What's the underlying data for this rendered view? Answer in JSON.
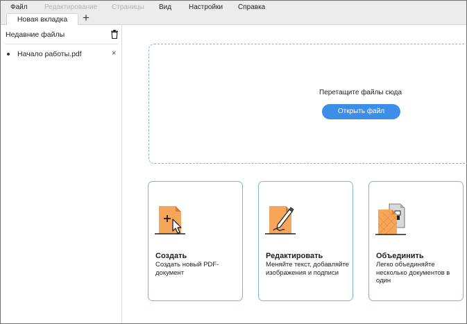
{
  "menubar": {
    "items": [
      {
        "label": "Файл",
        "enabled": true
      },
      {
        "label": "Редактирование",
        "enabled": false
      },
      {
        "label": "Страницы",
        "enabled": false
      },
      {
        "label": "Вид",
        "enabled": true
      },
      {
        "label": "Настройки",
        "enabled": true
      },
      {
        "label": "Справка",
        "enabled": true
      }
    ]
  },
  "tabs": {
    "active_label": "Новая вкладка",
    "new_tab_symbol": "+"
  },
  "sidebar": {
    "title": "Недавние файлы",
    "files": [
      {
        "name": "Начало работы.pdf",
        "close_symbol": "×"
      }
    ]
  },
  "dropzone": {
    "text": "Перетащите файлы сюда",
    "button_label": "Открыть файл"
  },
  "cards": [
    {
      "icon": "create-pdf-icon",
      "title": "Создать",
      "desc": "Создать новый PDF-документ"
    },
    {
      "icon": "edit-pdf-icon",
      "title": "Редактировать",
      "desc": "Меняйте текст, добавляйте изображения и подписи"
    },
    {
      "icon": "merge-pdf-icon",
      "title": "Объединить",
      "desc": "Легко объединяйте несколько документов в один"
    }
  ],
  "colors": {
    "accent": "#3d8ee6",
    "card_border": "#7fb3d8",
    "file_orange": "#f5a65b"
  }
}
